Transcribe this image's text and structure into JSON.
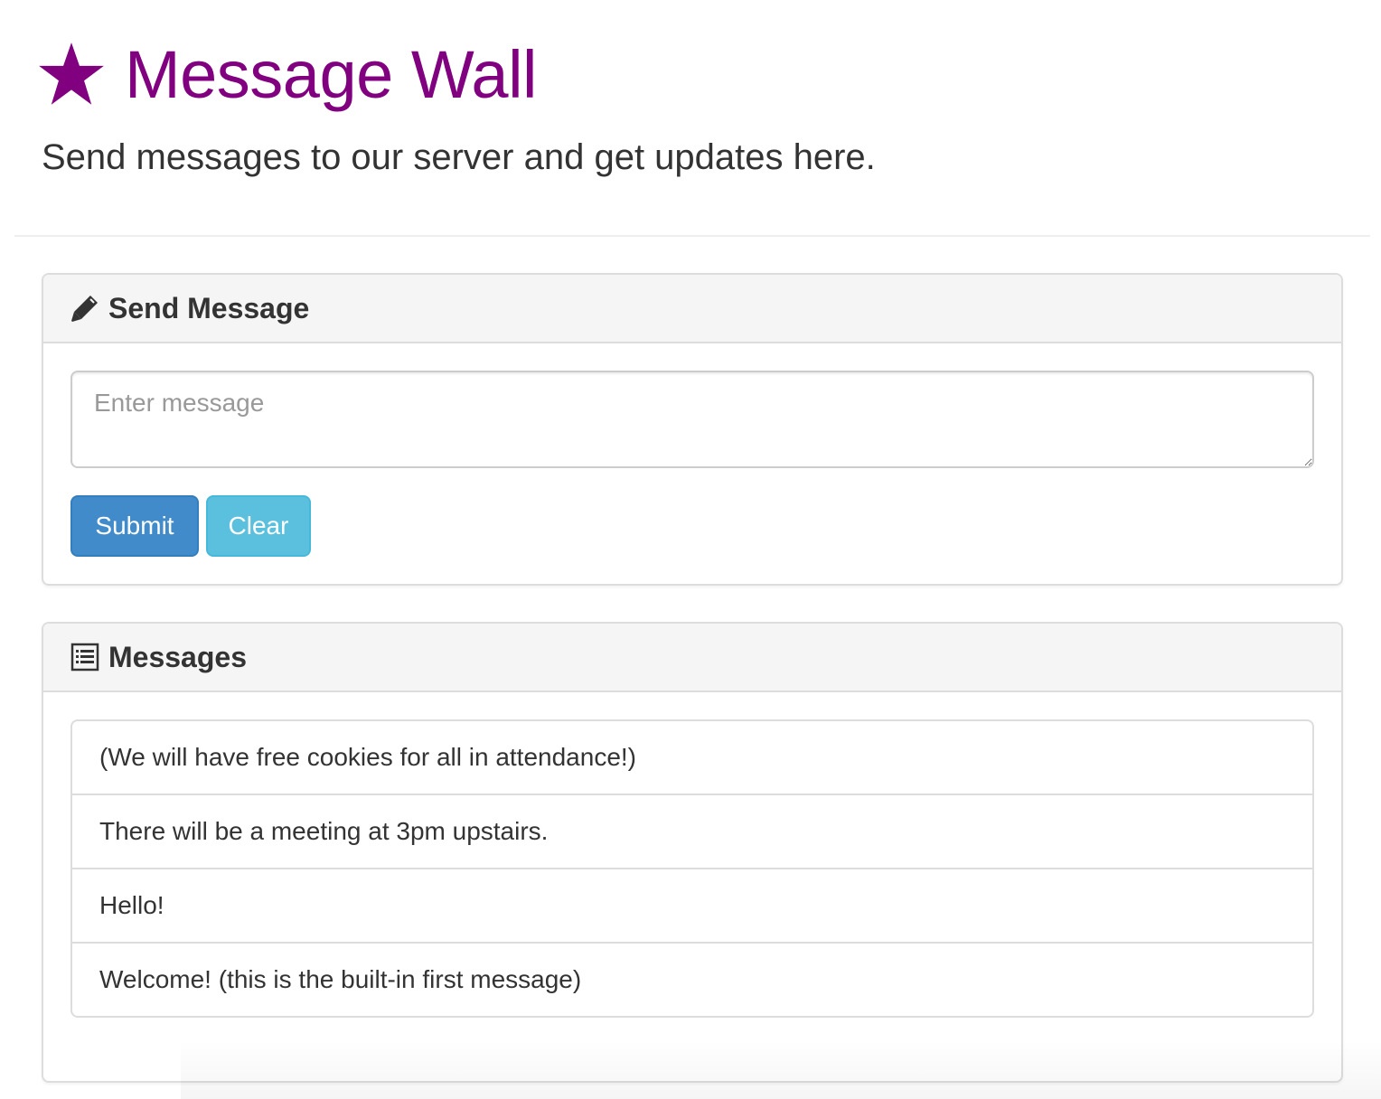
{
  "header": {
    "icon": "star-icon",
    "title": "Message Wall",
    "subtitle": "Send messages to our server and get updates here."
  },
  "send_panel": {
    "icon": "pencil-icon",
    "title": "Send Message",
    "input": {
      "value": "",
      "placeholder": "Enter message"
    },
    "submit_label": "Submit",
    "clear_label": "Clear"
  },
  "messages_panel": {
    "icon": "list-icon",
    "title": "Messages",
    "items": [
      "(We will have free cookies for all in attendance!)",
      "There will be a meeting at 3pm upstairs.",
      "Hello!",
      "Welcome! (this is the built-in first message)"
    ]
  },
  "colors": {
    "title": "#800080",
    "submit": "#428bca",
    "clear": "#5bc0de",
    "panel_heading": "#f5f5f5"
  }
}
